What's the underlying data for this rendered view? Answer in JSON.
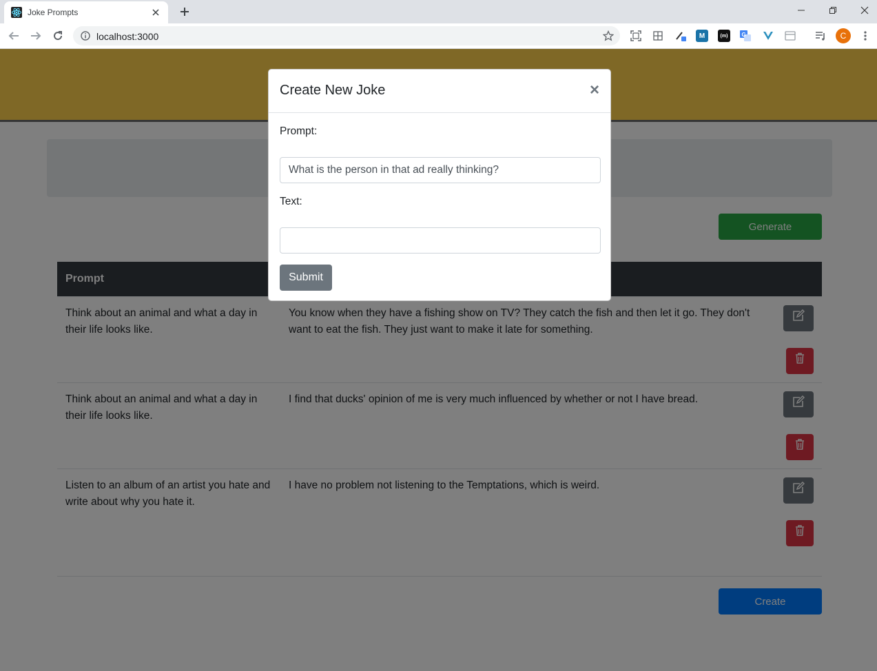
{
  "browser": {
    "tab_title": "Joke Prompts",
    "url": "localhost:3000",
    "profile_initial": "C"
  },
  "page": {
    "generate_label": "Generate",
    "create_label": "Create",
    "table": {
      "headers": [
        "Prompt"
      ],
      "rows": [
        {
          "prompt": "Think about an animal and what a day in their life looks like.",
          "text": "You know when they have a fishing show on TV? They catch the fish and then let it go. They don't want to eat the fish. They just want to make it late for something."
        },
        {
          "prompt": "Think about an animal and what a day in their life looks like.",
          "text": "I find that ducks' opinion of me is very much influenced by whether or not I have bread."
        },
        {
          "prompt": "Listen to an album of an artist you hate and write about why you hate it.",
          "text": "I have no problem not listening to the Temptations, which is weird."
        }
      ]
    }
  },
  "modal": {
    "title": "Create New Joke",
    "close_symbol": "×",
    "prompt_label": "Prompt:",
    "prompt_value": "What is the person in that ad really thinking?",
    "text_label": "Text:",
    "text_value": "",
    "submit_label": "Submit"
  },
  "colors": {
    "header_yellow": "#ffd04d",
    "generate_green": "#28a745",
    "create_blue": "#007bff",
    "edit_gray": "#6c757d",
    "delete_red": "#dc3545",
    "table_head_dark": "#343a40"
  }
}
